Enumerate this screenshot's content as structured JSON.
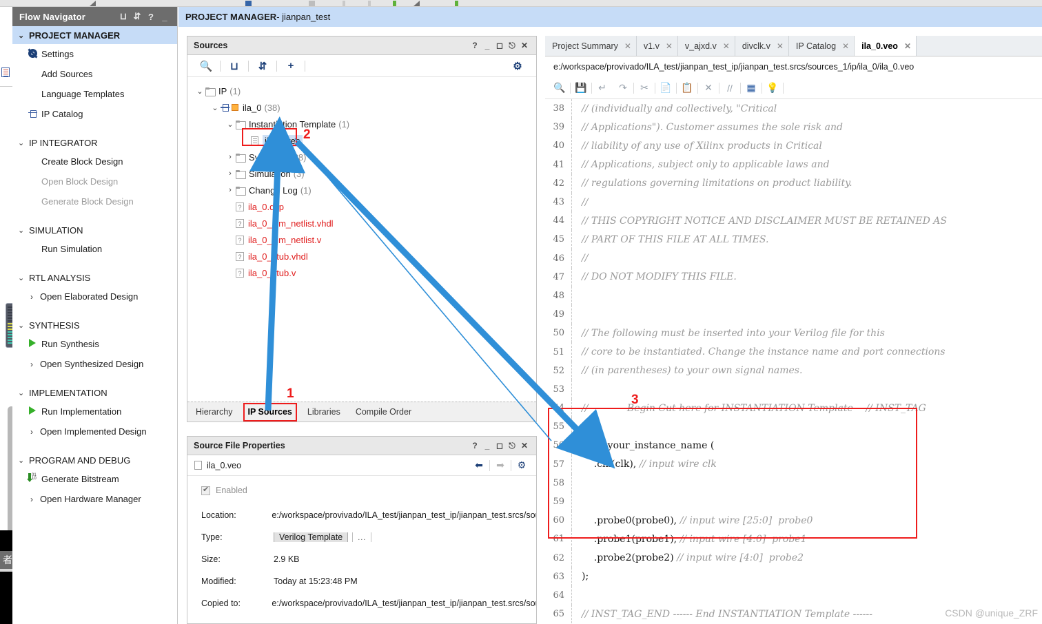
{
  "window": {
    "project_manager_title_bold": "PROJECT MANAGER",
    "project_manager_title_rest": " - jianpan_test"
  },
  "flow_navigator": {
    "title": "Flow Navigator",
    "header_icons": [
      "collapse-all-icon",
      "expand-collapse-icon",
      "help-icon",
      "minimize-icon"
    ],
    "sections": [
      {
        "label": "PROJECT MANAGER",
        "selected": true,
        "items": [
          {
            "label": "Settings",
            "icon": "gear-icon",
            "dim": false
          },
          {
            "label": "Add Sources",
            "icon": "none",
            "dim": false
          },
          {
            "label": "Language Templates",
            "icon": "none",
            "dim": false
          },
          {
            "label": "IP Catalog",
            "icon": "ip-catalog-icon",
            "dim": false
          }
        ]
      },
      {
        "label": "IP INTEGRATOR",
        "selected": false,
        "items": [
          {
            "label": "Create Block Design",
            "icon": "none",
            "dim": false
          },
          {
            "label": "Open Block Design",
            "icon": "none",
            "dim": true
          },
          {
            "label": "Generate Block Design",
            "icon": "none",
            "dim": true
          }
        ]
      },
      {
        "label": "SIMULATION",
        "selected": false,
        "items": [
          {
            "label": "Run Simulation",
            "icon": "none",
            "dim": false
          }
        ]
      },
      {
        "label": "RTL ANALYSIS",
        "selected": false,
        "items": [
          {
            "label": "Open Elaborated Design",
            "icon": "chevron-right-icon",
            "dim": false
          }
        ]
      },
      {
        "label": "SYNTHESIS",
        "selected": false,
        "items": [
          {
            "label": "Run Synthesis",
            "icon": "play-icon",
            "dim": false
          },
          {
            "label": "Open Synthesized Design",
            "icon": "chevron-right-icon",
            "dim": false
          }
        ]
      },
      {
        "label": "IMPLEMENTATION",
        "selected": false,
        "items": [
          {
            "label": "Run Implementation",
            "icon": "play-icon",
            "dim": false
          },
          {
            "label": "Open Implemented Design",
            "icon": "chevron-right-icon",
            "dim": false
          }
        ]
      },
      {
        "label": "PROGRAM AND DEBUG",
        "selected": false,
        "items": [
          {
            "label": "Generate Bitstream",
            "icon": "bitstream-icon",
            "dim": false
          },
          {
            "label": "Open Hardware Manager",
            "icon": "chevron-right-icon",
            "dim": false
          }
        ]
      }
    ]
  },
  "sources_panel": {
    "title": "Sources",
    "toolbar": [
      "search-icon",
      "collapse-all-icon",
      "expand-all-icon",
      "add-sources-icon",
      "settings-gear-icon"
    ],
    "tree": [
      {
        "indent": 0,
        "chev": "v",
        "icon": "folder-icon",
        "name": "IP",
        "count": "(1)",
        "red": false,
        "selected": false
      },
      {
        "indent": 1,
        "chev": "v",
        "icon": "ip-icon",
        "name": "ila_0",
        "count": "(38)",
        "red": false,
        "selected": false
      },
      {
        "indent": 2,
        "chev": "v",
        "icon": "folder-icon",
        "name": "Instantiation Template",
        "count": "(1)",
        "red": false,
        "selected": false
      },
      {
        "indent": 3,
        "chev": "",
        "icon": "file-icon",
        "name": "ila_0.veo",
        "count": "",
        "red": false,
        "selected": true
      },
      {
        "indent": 2,
        "chev": ">",
        "icon": "folder-icon",
        "name": "Synthesis",
        "count": "(28)",
        "red": false,
        "selected": false
      },
      {
        "indent": 2,
        "chev": ">",
        "icon": "folder-icon",
        "name": "Simulation",
        "count": "(3)",
        "red": false,
        "selected": false
      },
      {
        "indent": 2,
        "chev": ">",
        "icon": "folder-icon",
        "name": "Change Log",
        "count": "(1)",
        "red": false,
        "selected": false
      },
      {
        "indent": 2,
        "chev": "",
        "icon": "unknown-file-icon",
        "name": "ila_0.dcp",
        "count": "",
        "red": true,
        "selected": false
      },
      {
        "indent": 2,
        "chev": "",
        "icon": "unknown-file-icon",
        "name": "ila_0_sim_netlist.vhdl",
        "count": "",
        "red": true,
        "selected": false
      },
      {
        "indent": 2,
        "chev": "",
        "icon": "unknown-file-icon",
        "name": "ila_0_sim_netlist.v",
        "count": "",
        "red": true,
        "selected": false
      },
      {
        "indent": 2,
        "chev": "",
        "icon": "unknown-file-icon",
        "name": "ila_0_stub.vhdl",
        "count": "",
        "red": true,
        "selected": false
      },
      {
        "indent": 2,
        "chev": "",
        "icon": "unknown-file-icon",
        "name": "ila_0_stub.v",
        "count": "",
        "red": true,
        "selected": false
      }
    ],
    "tabs": [
      {
        "label": "Hierarchy",
        "active": false
      },
      {
        "label": "IP Sources",
        "active": true
      },
      {
        "label": "Libraries",
        "active": false
      },
      {
        "label": "Compile Order",
        "active": false
      }
    ]
  },
  "source_file_properties": {
    "title": "Source File Properties",
    "file_name": "ila_0.veo",
    "enabled_label": "Enabled",
    "enabled_checked": true,
    "rows": [
      {
        "key": "Location:",
        "value": "e:/workspace/provivado/ILA_test/jianpan_test_ip/jianpan_test.srcs/sour",
        "type": "text"
      },
      {
        "key": "Type:",
        "value": "Verilog Template",
        "type": "pill",
        "more": "..."
      },
      {
        "key": "Size:",
        "value": "2.9 KB",
        "type": "text"
      },
      {
        "key": "Modified:",
        "value": "Today at 15:23:48 PM",
        "type": "text"
      },
      {
        "key": "Copied to:",
        "value": "e:/workspace/provivado/ILA_test/jianpan_test_ip/jianpan_test.srcs/sour",
        "type": "text"
      }
    ]
  },
  "editor": {
    "tabs": [
      {
        "label": "Project Summary",
        "active": false
      },
      {
        "label": "v1.v",
        "active": false
      },
      {
        "label": "v_ajxd.v",
        "active": false
      },
      {
        "label": "divclk.v",
        "active": false
      },
      {
        "label": "IP Catalog",
        "active": false
      },
      {
        "label": "ila_0.veo",
        "active": true
      }
    ],
    "path": "e:/workspace/provivado/ILA_test/jianpan_test_ip/jianpan_test.srcs/sources_1/ip/ila_0/ila_0.veo",
    "toolbar": [
      "search-icon",
      "save-icon",
      "undo-icon",
      "redo-icon",
      "cut-icon",
      "copy-icon",
      "paste-icon",
      "delete-icon",
      "comment-icon",
      "columns-icon",
      "bulb-icon"
    ],
    "lines": [
      {
        "no": "38",
        "text": "// (individually and collectively, \"Critical",
        "comment": true
      },
      {
        "no": "39",
        "text": "// Applications\"). Customer assumes the sole risk and",
        "comment": true
      },
      {
        "no": "40",
        "text": "// liability of any use of Xilinx products in Critical",
        "comment": true
      },
      {
        "no": "41",
        "text": "// Applications, subject only to applicable laws and",
        "comment": true
      },
      {
        "no": "42",
        "text": "// regulations governing limitations on product liability.",
        "comment": true
      },
      {
        "no": "43",
        "text": "//",
        "comment": true
      },
      {
        "no": "44",
        "text": "// THIS COPYRIGHT NOTICE AND DISCLAIMER MUST BE RETAINED AS",
        "comment": true
      },
      {
        "no": "45",
        "text": "// PART OF THIS FILE AT ALL TIMES.",
        "comment": true
      },
      {
        "no": "46",
        "text": "//",
        "comment": true
      },
      {
        "no": "47",
        "text": "// DO NOT MODIFY THIS FILE.",
        "comment": true
      },
      {
        "no": "48",
        "text": "",
        "comment": true
      },
      {
        "no": "49",
        "text": "",
        "comment": true
      },
      {
        "no": "50",
        "text": "// The following must be inserted into your Verilog file for this",
        "comment": true
      },
      {
        "no": "51",
        "text": "// core to be instantiated. Change the instance name and port connections",
        "comment": true
      },
      {
        "no": "52",
        "text": "// (in parentheses) to your own signal names.",
        "comment": true
      },
      {
        "no": "53",
        "text": "",
        "comment": true
      },
      {
        "no": "54",
        "text": "//----------- Begin Cut here for INSTANTIATION Template ---// INST_TAG",
        "comment": true
      },
      {
        "no": "55",
        "text": "",
        "comment": true
      },
      {
        "no": "56",
        "text": "ila_0 your_instance_name (",
        "comment": false,
        "code": "ila_0 your_instance_name (",
        "trail": ""
      },
      {
        "no": "57",
        "text": "    .clk(clk), // input wire clk",
        "comment": false,
        "code": "    .clk(clk), ",
        "trail": "// input wire clk"
      },
      {
        "no": "58",
        "text": "",
        "comment": false,
        "code": "",
        "trail": ""
      },
      {
        "no": "59",
        "text": "",
        "comment": false,
        "code": "",
        "trail": ""
      },
      {
        "no": "60",
        "text": "    .probe0(probe0), // input wire [25:0]  probe0",
        "comment": false,
        "code": "    .probe0(probe0), ",
        "trail": "// input wire [25:0]  probe0"
      },
      {
        "no": "61",
        "text": "    .probe1(probe1), // input wire [4:0]  probe1",
        "comment": false,
        "code": "    .probe1(probe1), ",
        "trail": "// input wire [4:0]  probe1"
      },
      {
        "no": "62",
        "text": "    .probe2(probe2) // input wire [4:0]  probe2",
        "comment": false,
        "code": "    .probe2(probe2) ",
        "trail": "// input wire [4:0]  probe2"
      },
      {
        "no": "63",
        "text": ");",
        "comment": false,
        "code": ");",
        "trail": ""
      },
      {
        "no": "64",
        "text": "",
        "comment": true
      },
      {
        "no": "65",
        "text": "// INST_TAG_END ------ End INSTANTIATION Template ------",
        "comment": true
      }
    ]
  },
  "annotations": {
    "markers": [
      {
        "id": "1",
        "target": "ip-sources-tab"
      },
      {
        "id": "2",
        "target": "ila_0.veo-tree-node"
      },
      {
        "id": "3",
        "target": "instantiation-template-code-block"
      }
    ],
    "color": "#ee1c1c",
    "arrow_color": "#2f8fd8"
  },
  "watermark": "CSDN @unique_ZRF"
}
